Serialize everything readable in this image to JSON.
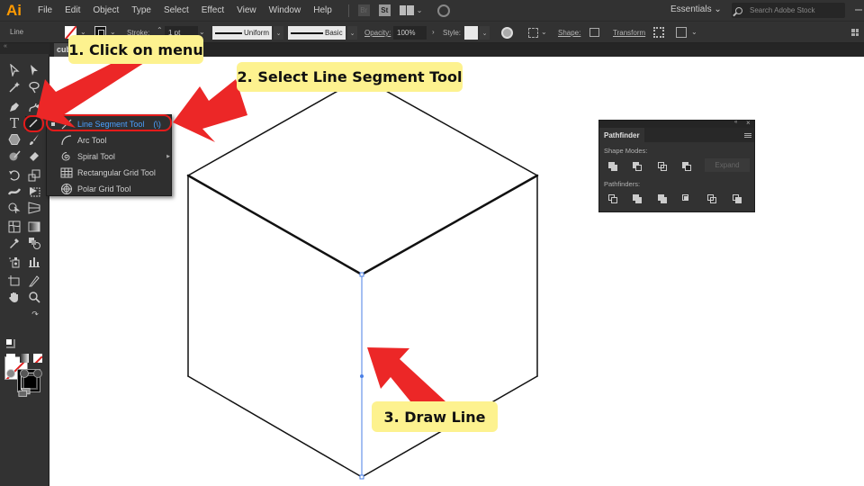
{
  "app": {
    "logo": "Ai",
    "menu": [
      "File",
      "Edit",
      "Object",
      "Type",
      "Select",
      "Effect",
      "View",
      "Window",
      "Help"
    ],
    "bridge_badge": "Br",
    "stock_badge": "St",
    "workspace": "Essentials",
    "search_placeholder": "Search Adobe Stock"
  },
  "control_bar": {
    "selection_type": "Line",
    "stroke_label": "Stroke:",
    "stroke_weight": "1 pt",
    "profile_uniform": "Uniform",
    "brush_basic": "Basic",
    "opacity_label": "Opacity:",
    "opacity_value": "100%",
    "style_label": "Style:",
    "shape_label": "Shape:",
    "transform_label": "Transform"
  },
  "document": {
    "tab_name": "cube"
  },
  "toolbar": {
    "collapse_glyph": "«",
    "type_tool_glyph": "T"
  },
  "flyout": {
    "items": [
      {
        "label": "Line Segment Tool",
        "shortcut": "(\\)",
        "selected": true
      },
      {
        "label": "Arc Tool"
      },
      {
        "label": "Spiral Tool"
      },
      {
        "label": "Rectangular Grid Tool"
      },
      {
        "label": "Polar Grid Tool"
      }
    ]
  },
  "pathfinder": {
    "title": "Pathfinder",
    "collapse_glyph": "«",
    "close_glyph": "×",
    "shape_modes_label": "Shape Modes:",
    "expand_label": "Expand",
    "pathfinders_label": "Pathfinders:"
  },
  "callouts": {
    "step1": "1. Click on menu",
    "step2": "2. Select Line Segment Tool",
    "step3": "3. Draw Line"
  },
  "colors": {
    "accent_blue": "#4aa0ff",
    "annotation_red": "#e41b1b",
    "callout_yellow": "#fdf28f",
    "ui_dark": "#323232",
    "ai_orange": "#ff9a00"
  }
}
